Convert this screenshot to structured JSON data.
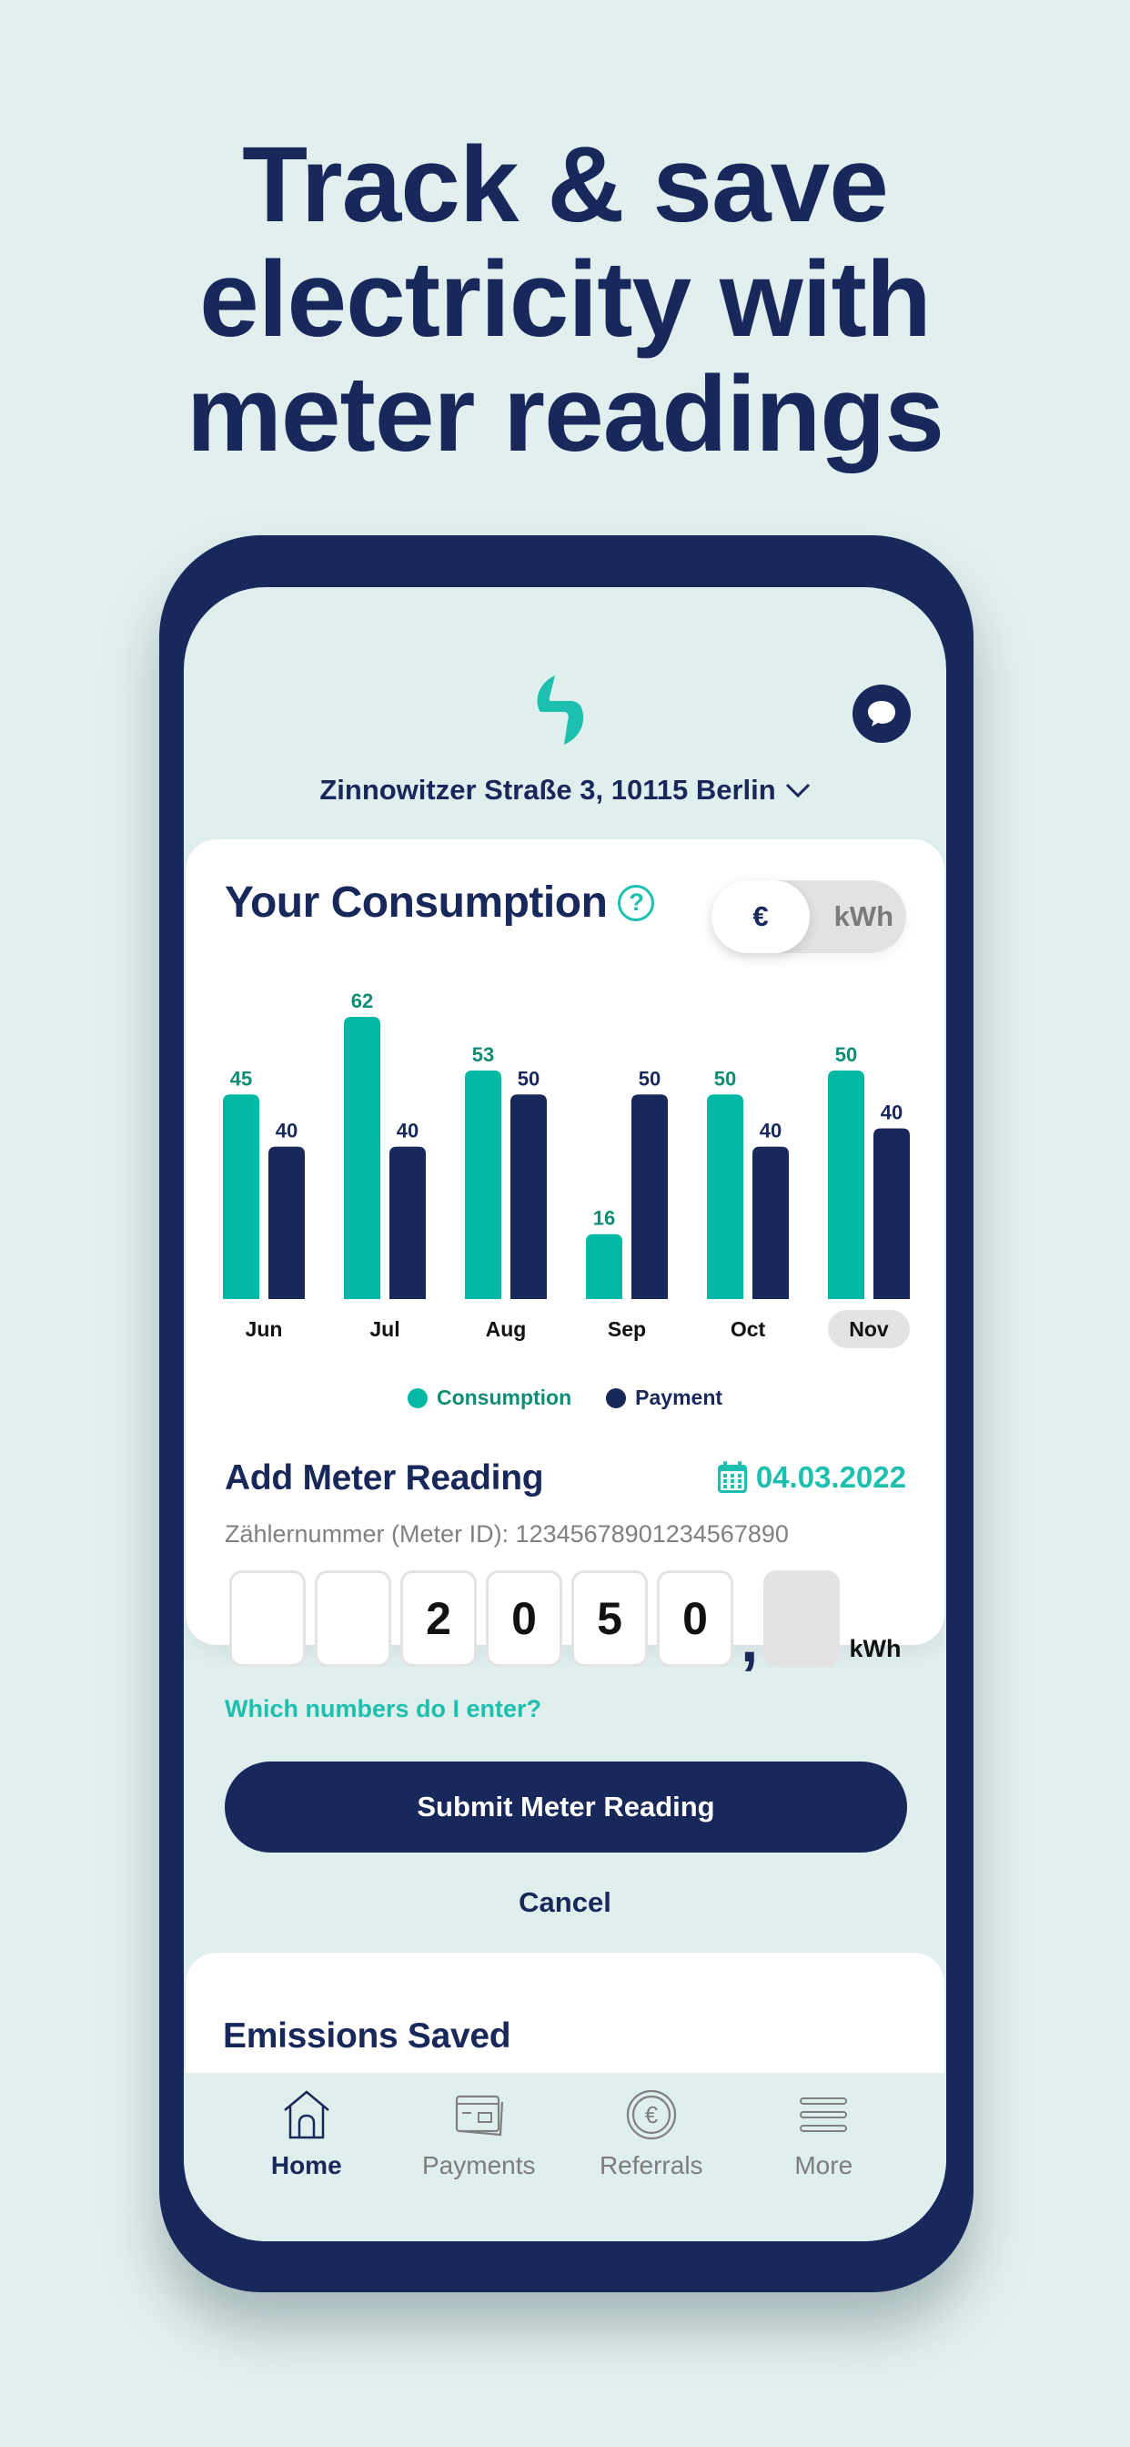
{
  "headline": {
    "lines": [
      "Track & save",
      "electricity with",
      "meter readings"
    ]
  },
  "header": {
    "logo_icon": "bolt-logo-icon",
    "chat_icon": "chat-bubble-icon",
    "address": "Zinnowitzer Straße 3, 10115 Berlin",
    "address_chevron_icon": "chevron-down-icon"
  },
  "consumption": {
    "title": "Your Consumption",
    "help_icon": "question-circle-icon",
    "help_glyph": "?",
    "toggle": {
      "options": [
        "€",
        "kWh"
      ],
      "selected": "€"
    }
  },
  "chart_data": {
    "type": "bar",
    "title": "Your Consumption",
    "categories": [
      "Jun",
      "Jul",
      "Aug",
      "Sep",
      "Oct",
      "Nov"
    ],
    "highlighted_category": "Nov",
    "series": [
      {
        "name": "Consumption",
        "color": "#00b8a4",
        "label_color": "#0e8c74",
        "values": [
          45,
          62,
          53,
          16,
          50,
          50
        ],
        "display_level": [
          0.725,
          1.0,
          0.81,
          0.23,
          0.725,
          0.81
        ]
      },
      {
        "name": "Payment",
        "color": "#18285a",
        "label_color": "#18285a",
        "values": [
          40,
          40,
          50,
          50,
          40,
          40
        ],
        "display_level": [
          0.54,
          0.54,
          0.725,
          0.725,
          0.54,
          0.605
        ]
      }
    ],
    "xlabel": "",
    "ylabel": "",
    "grid": false,
    "legend": "bottom-center"
  },
  "legend": [
    {
      "label": "Consumption",
      "color": "#00b8a4",
      "text_color": "#0e8c74"
    },
    {
      "label": "Payment",
      "color": "#18285a",
      "text_color": "#18285a"
    }
  ],
  "meter": {
    "title": "Add Meter Reading",
    "date_icon": "calendar-icon",
    "date": "04.03.2022",
    "meter_id_label": "Zählernummer (Meter ID): 12345678901234567890",
    "digits": [
      "",
      "",
      "2",
      "0",
      "5",
      "0"
    ],
    "decimal_separator": ",",
    "decimal_digit": "",
    "unit": "kWh",
    "help_link": "Which numbers do I enter?",
    "submit_label": "Submit Meter Reading",
    "cancel_label": "Cancel"
  },
  "emissions": {
    "title": "Emissions Saved"
  },
  "tabbar": {
    "items": [
      {
        "label": "Home",
        "icon": "home-icon",
        "active": true
      },
      {
        "label": "Payments",
        "icon": "credit-card-icon",
        "active": false
      },
      {
        "label": "Referrals",
        "icon": "euro-coin-icon",
        "active": false
      },
      {
        "label": "More",
        "icon": "menu-icon",
        "active": false
      }
    ]
  },
  "colors": {
    "navy": "#18285a",
    "teal": "#1dbfae",
    "background": "#e1f0ef"
  }
}
